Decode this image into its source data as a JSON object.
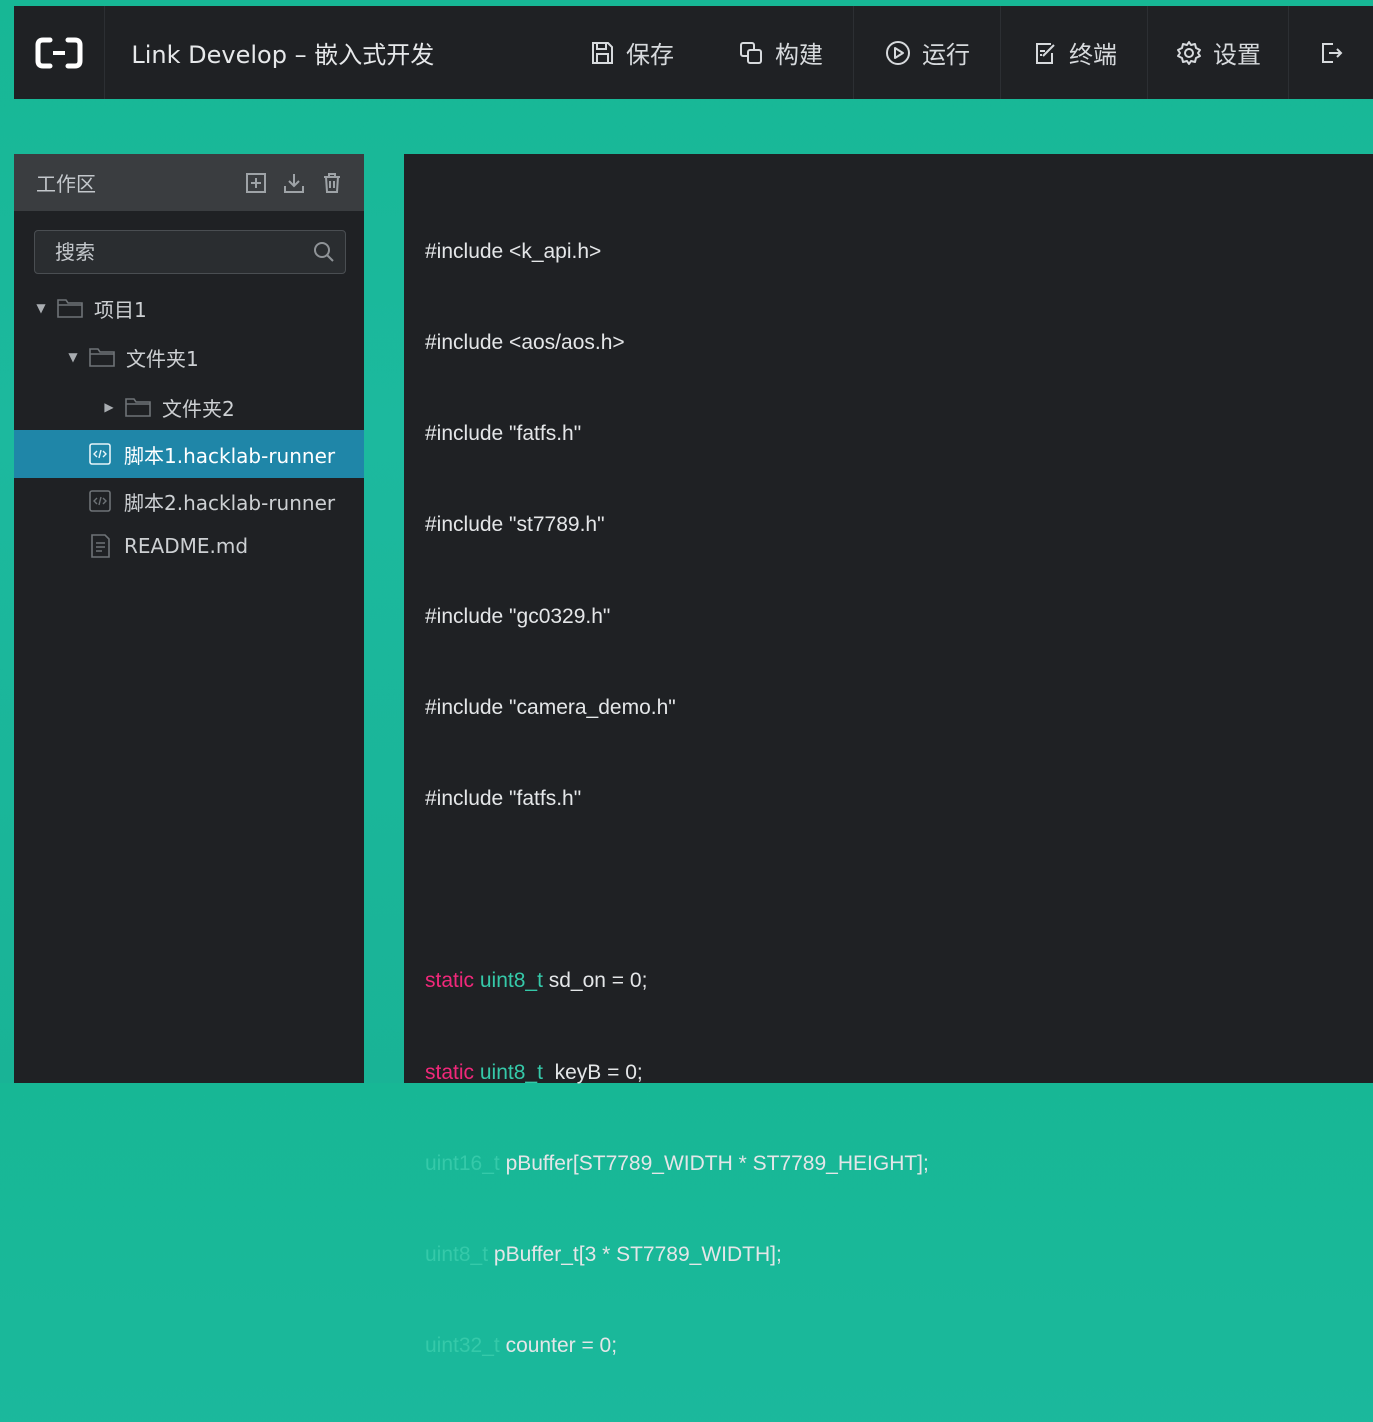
{
  "app": {
    "title": "Link Develop – 嵌入式开发",
    "logo_icon": "bracket-logo-icon"
  },
  "toolbar": {
    "save_label": "保存",
    "build_label": "构建",
    "run_label": "运行",
    "terminal_label": "终端",
    "settings_label": "设置",
    "exit_icon": "exit-icon"
  },
  "sidebar": {
    "header_title": "工作区",
    "actions": [
      "add-icon",
      "download-icon",
      "trash-icon"
    ],
    "search_placeholder": "搜索",
    "tree": [
      {
        "label": "项目1",
        "type": "folder",
        "expanded": true
      },
      {
        "label": "文件夹1",
        "type": "folder",
        "expanded": true
      },
      {
        "label": "文件夹2",
        "type": "folder",
        "expanded": false
      },
      {
        "label": "脚本1.hacklab-runner",
        "type": "script",
        "selected": true
      },
      {
        "label": "脚本2.hacklab-runner",
        "type": "script",
        "selected": false
      },
      {
        "label": "README.md",
        "type": "markdown",
        "selected": false
      }
    ]
  },
  "editor": {
    "lines": {
      "l1": "#include <k_api.h>",
      "l2": "#include <aos/aos.h>",
      "l3": "#include \"fatfs.h\"",
      "l4": "#include \"st7789.h\"",
      "l5": "#include \"gc0329.h\"",
      "l6": "#include \"camera_demo.h\"",
      "l7": "#include \"fatfs.h\"",
      "l9": {
        "kw": "static",
        "type": "uint8_t",
        "rest": " sd_on = 0;"
      },
      "l10": {
        "kw": "static",
        "type": "uint8_t",
        "rest": "  keyB = 0;"
      },
      "l11": {
        "type": "uint16_t",
        "rest": " pBuffer[ST7789_WIDTH * ST7789_HEIGHT];"
      },
      "l12": {
        "type": "uint8_t",
        "rest": " pBuffer_t[3 * ST7789_WIDTH];"
      },
      "l13": {
        "type": "uint32_t",
        "rest": " counter = 0;"
      }
    }
  },
  "colors": {
    "accent": "#1db89a",
    "panel": "#1f2124",
    "selected": "#1f86a8",
    "keyword": "#f0287a",
    "type": "#35c9a9"
  }
}
